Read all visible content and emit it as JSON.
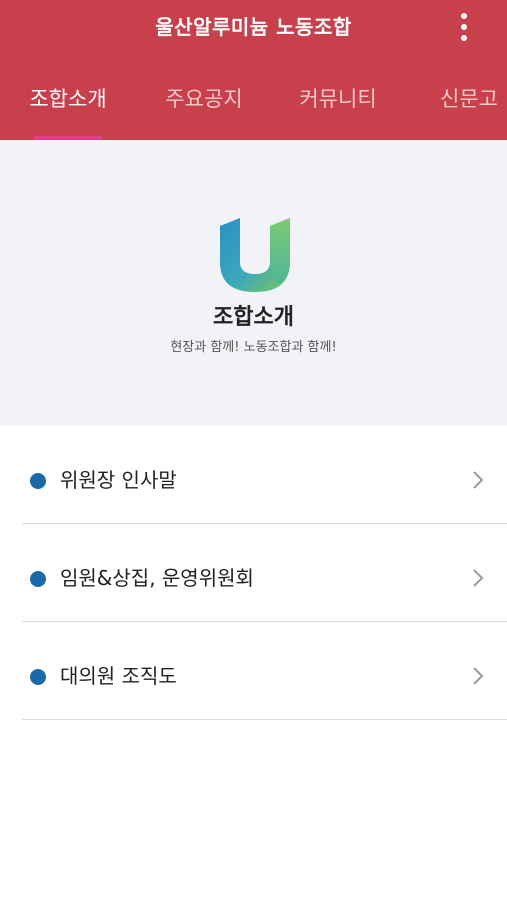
{
  "header": {
    "title": "울산알루미늄 노동조합",
    "menu_icon": "more-vertical-icon",
    "background": "#c8404b"
  },
  "tabs": [
    {
      "label": "조합소개",
      "active": true
    },
    {
      "label": "주요공지",
      "active": false
    },
    {
      "label": "커뮤니티",
      "active": false
    },
    {
      "label": "신문고",
      "active": false
    }
  ],
  "hero": {
    "logo_icon": "union-u-logo-icon",
    "title": "조합소개",
    "subtitle": "현장과 함께! 노동조합과 함께!"
  },
  "menu_list": [
    {
      "label": "위원장 인사말",
      "icon": "chevron-right-icon"
    },
    {
      "label": "임원&상집, 운영위원회",
      "icon": "chevron-right-icon"
    },
    {
      "label": "대의원 조직도",
      "icon": "chevron-right-icon"
    }
  ],
  "colors": {
    "accent": "#c8404b",
    "tab_indicator": "#e23f8a",
    "bullet": "#1a6aa9"
  }
}
